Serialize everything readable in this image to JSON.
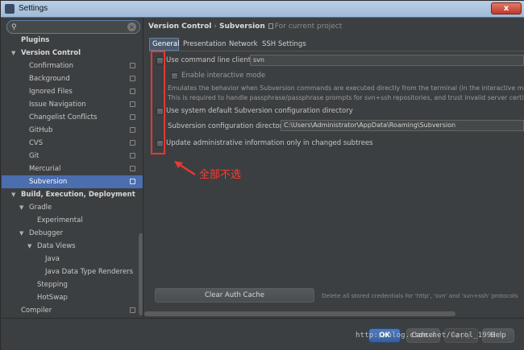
{
  "window": {
    "title": "Settings",
    "close_label": "x"
  },
  "search": {
    "value": "",
    "placeholder": "",
    "icon": "search-icon"
  },
  "sidebar": {
    "items": [
      {
        "label": "Plugins",
        "bold": true
      },
      {
        "label": "Version Control",
        "bold": true,
        "expanded": true
      },
      {
        "label": "Confirmation",
        "project_tag": true
      },
      {
        "label": "Background",
        "project_tag": true
      },
      {
        "label": "Ignored Files",
        "project_tag": true
      },
      {
        "label": "Issue Navigation",
        "project_tag": true
      },
      {
        "label": "Changelist Conflicts",
        "project_tag": true
      },
      {
        "label": "GitHub",
        "project_tag": true
      },
      {
        "label": "CVS",
        "project_tag": true
      },
      {
        "label": "Git",
        "project_tag": true
      },
      {
        "label": "Mercurial",
        "project_tag": true
      },
      {
        "label": "Subversion",
        "project_tag": true,
        "selected": true
      },
      {
        "label": "Build, Execution, Deployment",
        "bold": true,
        "expanded": true
      },
      {
        "label": "Gradle",
        "expanded": true
      },
      {
        "label": "Experimental"
      },
      {
        "label": "Debugger",
        "expanded": true
      },
      {
        "label": "Data Views",
        "expanded": true
      },
      {
        "label": "Java"
      },
      {
        "label": "Java Data Type Renderers"
      },
      {
        "label": "Stepping"
      },
      {
        "label": "HotSwap"
      },
      {
        "label": "Compiler",
        "project_tag": true
      }
    ]
  },
  "breadcrumb": {
    "parent": "Version Control",
    "separator": "›",
    "current": "Subversion",
    "note": "For current project"
  },
  "tabs": [
    "General",
    "Presentation",
    "Network",
    "SSH Settings"
  ],
  "general": {
    "use_cmd_client_label": "Use command line client:",
    "use_cmd_client_value": "svn",
    "enable_interactive_label": "Enable interactive mode",
    "interactive_desc_1": "Emulates the behavior when Subversion commands are executed directly from the terminal (in the interactive mode",
    "interactive_desc_2": "This is required to handle passphrase/passphrase prompts for svn+ssh repositories, and trust invalid server certificate",
    "system_default_label": "Use system default Subversion configuration directory",
    "config_dir_label": "Subversion configuration directory:",
    "config_dir_value": "C:\\Users\\Administrator\\AppData\\Roaming\\Subversion",
    "update_admin_label": "Update administrative information only in changed subtrees",
    "clear_auth_label": "Clear Auth Cache",
    "clear_auth_hint": "Delete all stored credentials for 'http', 'svn' and 'svn+ssh' protocols"
  },
  "annotation": {
    "text": "全部不选",
    "color": "#e53935"
  },
  "footer": {
    "ok": "OK",
    "cancel": "Cancel",
    "apply": "Apply",
    "help": "Help"
  },
  "watermark": "http://blog.csdn.net/Carol_1992"
}
